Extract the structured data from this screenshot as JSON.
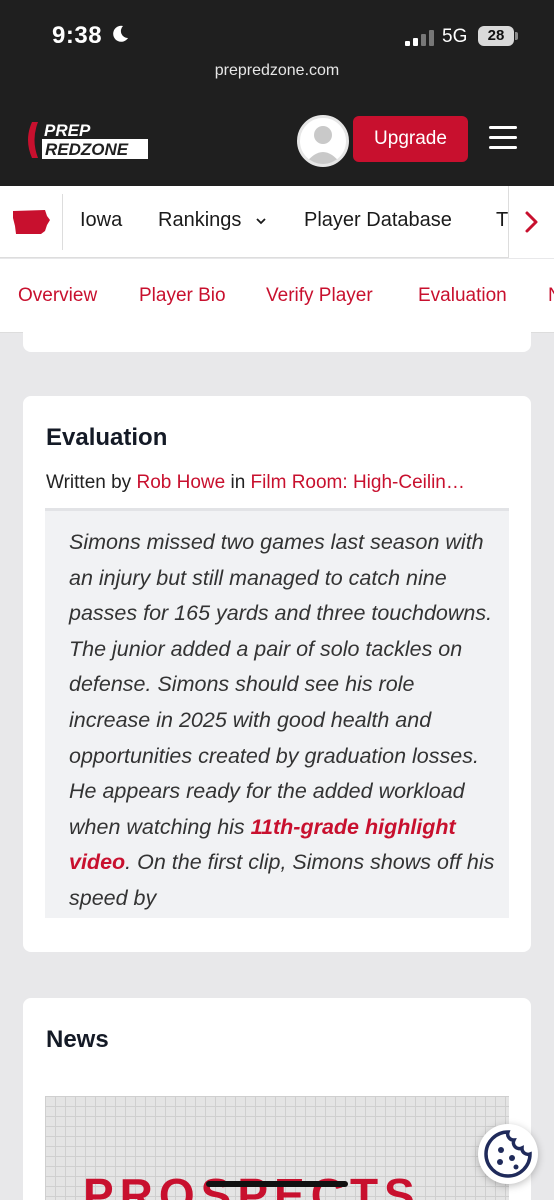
{
  "status_bar": {
    "time": "9:38",
    "network": "5G",
    "battery": "28"
  },
  "browser": {
    "url": "prepredzone.com"
  },
  "header": {
    "logo_line1": "PREP",
    "logo_line2": "REDZONE",
    "upgrade_label": "Upgrade"
  },
  "nav": {
    "items": [
      "Iowa",
      "Rankings",
      "Player Database",
      "T"
    ]
  },
  "tabs": {
    "items": [
      "Overview",
      "Player Bio",
      "Verify Player",
      "Evaluation",
      "N"
    ],
    "active": "Evaluation"
  },
  "evaluation": {
    "title": "Evaluation",
    "written_by": "Written by",
    "author": "Rob Howe",
    "in": "in",
    "article": "Film Room: High-Ceilin…",
    "text_before_link": "Simons missed two games last season with an injury but still managed to catch nine passes for 165 yards and three touchdowns. The junior added a pair of solo tackles on defense. Simons should see his role increase in 2025 with good health and opportunities created by graduation losses. He appears ready for the added workload when watching his ",
    "link_text": "11th-grade highlight video",
    "text_after_link": ". On the first clip, Simons shows off his speed by"
  },
  "news": {
    "title": "News",
    "image_text": "PROSPECTS"
  },
  "colors": {
    "brand_red": "#c8102e",
    "header_bg": "#1f1f1f",
    "page_bg": "#e8e8ea"
  },
  "icons": {
    "state": "iowa-state-icon",
    "nav_arrow": "chevron-right-icon",
    "menu": "hamburger-icon",
    "cookie": "cookie-icon"
  }
}
